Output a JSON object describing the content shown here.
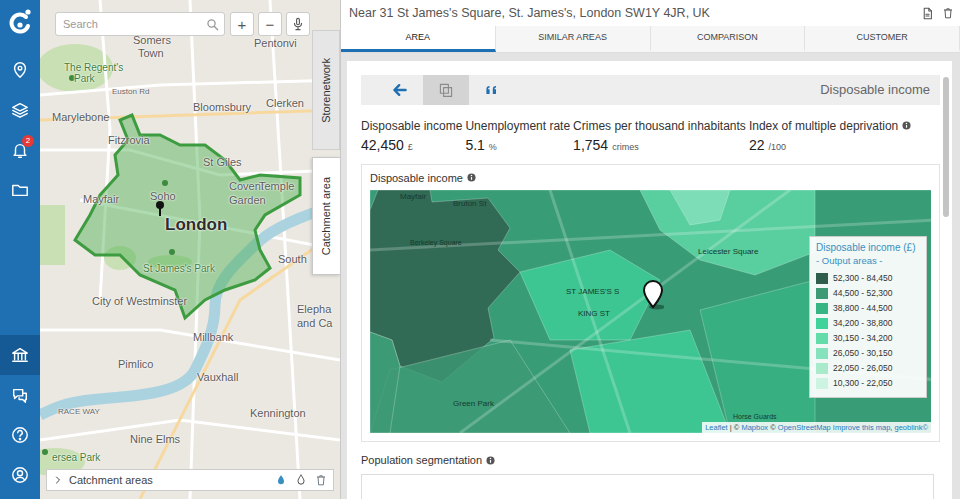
{
  "sidebar": {
    "top_items": [
      {
        "selected": false
      },
      {
        "selected": false
      },
      {
        "selected": false,
        "badge": "2"
      },
      {
        "selected": false
      }
    ],
    "bottom_items": [
      {
        "selected": true
      },
      {
        "selected": false
      },
      {
        "selected": false
      },
      {
        "selected": false
      }
    ]
  },
  "map": {
    "search": {
      "placeholder": "Search"
    },
    "zoom_in": "+",
    "zoom_out": "−",
    "labels": [
      {
        "text": "Somers",
        "kind": "place"
      },
      {
        "text": "Town",
        "kind": "place"
      },
      {
        "text": "Pentonvi",
        "kind": "place"
      },
      {
        "text": "The Regent's",
        "kind": "park"
      },
      {
        "text": "Park",
        "kind": "park"
      },
      {
        "text": "Euston Rd",
        "kind": "road"
      },
      {
        "text": "Marylebone",
        "kind": "place"
      },
      {
        "text": "Bloomsbury",
        "kind": "place"
      },
      {
        "text": "Clerken",
        "kind": "place"
      },
      {
        "text": "Fitzrovia",
        "kind": "place"
      },
      {
        "text": "St Giles",
        "kind": "place"
      },
      {
        "text": "Soho",
        "kind": "place"
      },
      {
        "text": "Covent",
        "kind": "place"
      },
      {
        "text": "Garden",
        "kind": "place"
      },
      {
        "text": "Temple",
        "kind": "place"
      },
      {
        "text": "Mayfair",
        "kind": "place"
      },
      {
        "text": "London",
        "kind": "city"
      },
      {
        "text": "St James's Park",
        "kind": "park"
      },
      {
        "text": "South",
        "kind": "place"
      },
      {
        "text": "City of Westminster",
        "kind": "place"
      },
      {
        "text": "Elepha",
        "kind": "place"
      },
      {
        "text": "and Ca",
        "kind": "place"
      },
      {
        "text": "Millbank",
        "kind": "place"
      },
      {
        "text": "RACE WAY",
        "kind": "road"
      },
      {
        "text": "Pimlico",
        "kind": "place"
      },
      {
        "text": "Vauxhall",
        "kind": "place"
      },
      {
        "text": "Kennington",
        "kind": "place"
      },
      {
        "text": "Nine Elms",
        "kind": "place"
      },
      {
        "text": "ersea Park",
        "kind": "park"
      }
    ],
    "footer": "Catchment areas"
  },
  "side_tabs": [
    {
      "label": "Storenetwork",
      "selected": false
    },
    {
      "label": "Catchment area",
      "selected": true
    }
  ],
  "panel": {
    "title": "Near 31 St James's Square, St. James's, London SW1Y 4JR, UK",
    "tabs": [
      {
        "label": "AREA",
        "selected": true
      },
      {
        "label": "SIMILAR AREAS",
        "selected": false
      },
      {
        "label": "COMPARISON",
        "selected": false
      },
      {
        "label": "CUSTOMER",
        "selected": false
      }
    ],
    "toolbar": {
      "buttons": [
        {
          "selected": false
        },
        {
          "selected": true
        },
        {
          "selected": false
        }
      ],
      "title": "Disposable income"
    },
    "stats": [
      {
        "label": "Disposable income",
        "value": "42,450",
        "unit": "£"
      },
      {
        "label": "Unemployment rate",
        "value": "5.1",
        "unit": "%"
      },
      {
        "label": "Crimes per thousand inhabitants",
        "value": "1,754",
        "unit": "crimes"
      },
      {
        "label": "Index of multiple deprivation",
        "value": "22",
        "unit": "/100"
      }
    ],
    "chart": {
      "title": "Disposable income",
      "legend": {
        "title": "Disposable income (£)",
        "subtitle": "- Output areas -",
        "items": [
          {
            "range": "52,300 - 84,450",
            "color": "#2f5e4d"
          },
          {
            "range": "44,500 - 52,300",
            "color": "#3d9a75"
          },
          {
            "range": "38,800 - 44,500",
            "color": "#37b584"
          },
          {
            "range": "34,200 - 38,800",
            "color": "#3fd29a"
          },
          {
            "range": "30,150 - 34,200",
            "color": "#63dcaa"
          },
          {
            "range": "26,050 - 30,150",
            "color": "#86e2bd"
          },
          {
            "range": "22,050 - 26,050",
            "color": "#a9eacd"
          },
          {
            "range": "10,300 - 22,050",
            "color": "#cdf3e2"
          }
        ]
      },
      "labels": [
        {
          "text": "Mayfair"
        },
        {
          "text": "Bruton St"
        },
        {
          "text": "Berkeley Square"
        },
        {
          "text": "Leicester Square"
        },
        {
          "text": "ST JAMES'S S"
        },
        {
          "text": "KING ST"
        },
        {
          "text": "Green Park"
        },
        {
          "text": "Horse Guards"
        }
      ],
      "attribution": [
        {
          "text": "Leaflet",
          "link": true
        },
        {
          "text": " | © ",
          "link": false
        },
        {
          "text": "Mapbox",
          "link": true
        },
        {
          "text": " © ",
          "link": false
        },
        {
          "text": "OpenStreetMap Improve this map",
          "link": true
        },
        {
          "text": ", ",
          "link": false
        },
        {
          "text": "geoblink©",
          "link": true
        }
      ]
    },
    "next_section": {
      "title": "Population segmentation"
    }
  }
}
